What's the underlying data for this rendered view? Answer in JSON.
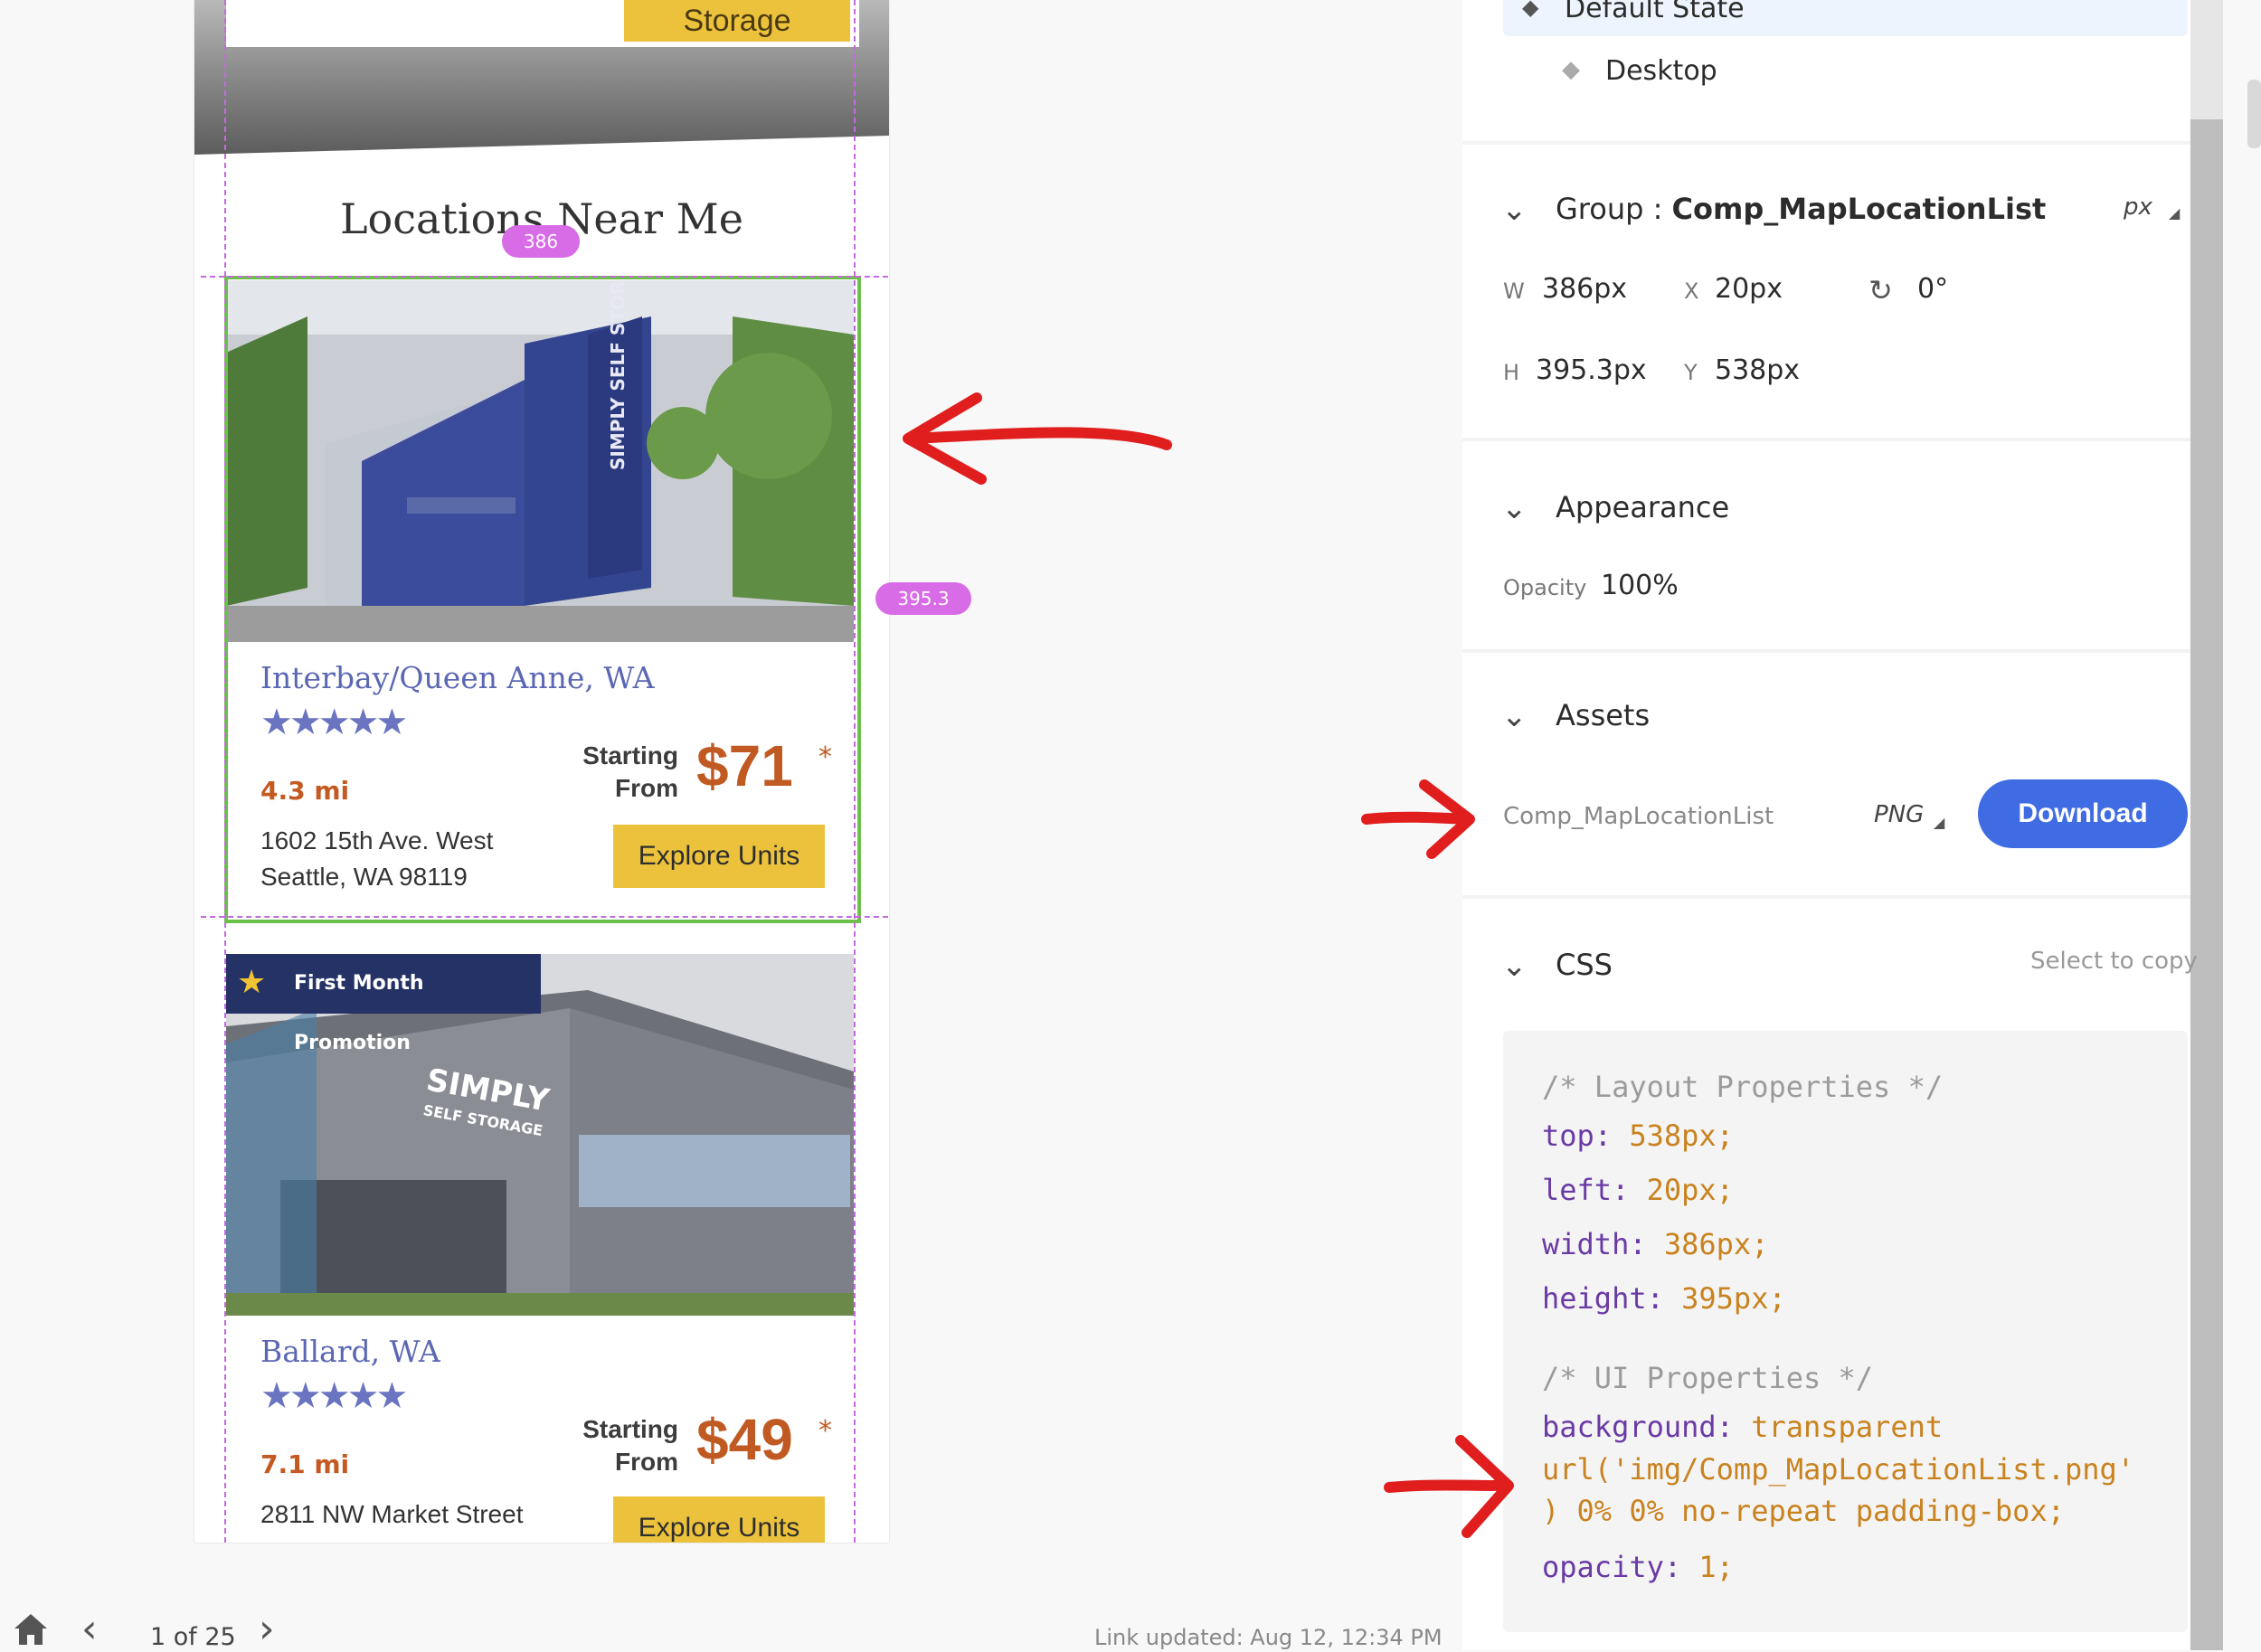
{
  "artboard": {
    "search_button_label": "Storage",
    "section_title": "Locations Near Me",
    "width_pill": "386",
    "height_pill": "395.3",
    "cards": [
      {
        "name": "Interbay/Queen Anne, WA",
        "rating_stars": "★★★★★",
        "distance": "4.3 mi",
        "starting_label_1": "Starting",
        "starting_label_2": "From",
        "price": "$71",
        "price_note": "*",
        "address_1": "1602 15th Ave. West",
        "address_2": "Seattle, WA 98119",
        "button": "Explore Units",
        "photo_sign": "SIMPLY SELF STORAGE"
      },
      {
        "promo": "First Month Promotion",
        "name": "Ballard, WA",
        "rating_stars": "★★★★★",
        "distance": "7.1 mi",
        "starting_label_1": "Starting",
        "starting_label_2": "From",
        "price": "$49",
        "price_note": "*",
        "address_1": "2811 NW Market Street",
        "button": "Explore Units",
        "photo_sign_1": "SIMPLY",
        "photo_sign_2": "SELF STORAGE"
      }
    ]
  },
  "bottom_bar": {
    "page_count": "1 of 25",
    "link_updated": "Link updated: Aug 12, 12:34 PM"
  },
  "inspector": {
    "states": {
      "default": "Default State",
      "desktop": "Desktop"
    },
    "group": {
      "prefix": "Group : ",
      "name": "Comp_MapLocationList",
      "unit": "px",
      "w_label": "W",
      "w_value": "386px",
      "x_label": "X",
      "x_value": "20px",
      "rotation": "0°",
      "h_label": "H",
      "h_value": "395.3px",
      "y_label": "Y",
      "y_value": "538px"
    },
    "appearance": {
      "title": "Appearance",
      "opacity_label": "Opacity",
      "opacity_value": "100%"
    },
    "assets": {
      "title": "Assets",
      "asset_name": "Comp_MapLocationList",
      "format": "PNG",
      "download": "Download"
    },
    "css": {
      "title": "CSS",
      "hint": "Select to copy",
      "layout_comment": "/* Layout Properties */",
      "top_prop": "top:",
      "top_val": "538px;",
      "left_prop": "left:",
      "left_val": "20px;",
      "width_prop": "width:",
      "width_val": "386px;",
      "height_prop": "height:",
      "height_val": "395px;",
      "ui_comment": "/* UI Properties */",
      "bg_prop": "background:",
      "bg_val_1": "transparent",
      "bg_val_2": "url('img/Comp_MapLocationList.png'",
      "bg_val_3": ") 0% 0% no-repeat padding-box;",
      "opacity_prop": "opacity:",
      "opacity_val": "1;"
    }
  },
  "colors": {
    "accent_blue": "#3f6ce2",
    "selection_green": "#6cc04a",
    "guide_magenta": "#c46adf",
    "annotation_red": "#e01e1e",
    "button_yellow": "#ecc23c"
  }
}
